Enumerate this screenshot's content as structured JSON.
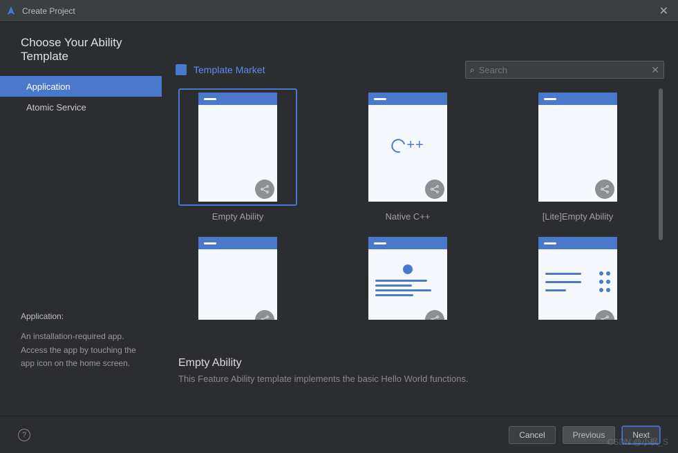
{
  "window": {
    "title": "Create Project"
  },
  "heading": "Choose Your Ability Template",
  "sidebar": {
    "items": [
      {
        "label": "Application",
        "active": true
      },
      {
        "label": "Atomic Service",
        "active": false
      }
    ],
    "info": {
      "title": "Application:",
      "body": "An installation-required app. Access the app by touching the app icon on the home screen."
    }
  },
  "header": {
    "market_link": "Template Market",
    "search_placeholder": "Search"
  },
  "templates": [
    {
      "label": "Empty Ability",
      "kind": "empty",
      "selected": true
    },
    {
      "label": "Native C++",
      "kind": "cpp",
      "selected": false
    },
    {
      "label": "[Lite]Empty Ability",
      "kind": "lite",
      "selected": false
    },
    {
      "label": "",
      "kind": "empty2",
      "selected": false
    },
    {
      "label": "",
      "kind": "lines",
      "selected": false
    },
    {
      "label": "",
      "kind": "settings",
      "selected": false
    }
  ],
  "selected_template": {
    "title": "Empty Ability",
    "description": "This Feature Ability template implements the basic Hello World functions."
  },
  "footer": {
    "cancel": "Cancel",
    "previous": "Previous",
    "next": "Next"
  },
  "watermark": "CSDN @小枫_S"
}
